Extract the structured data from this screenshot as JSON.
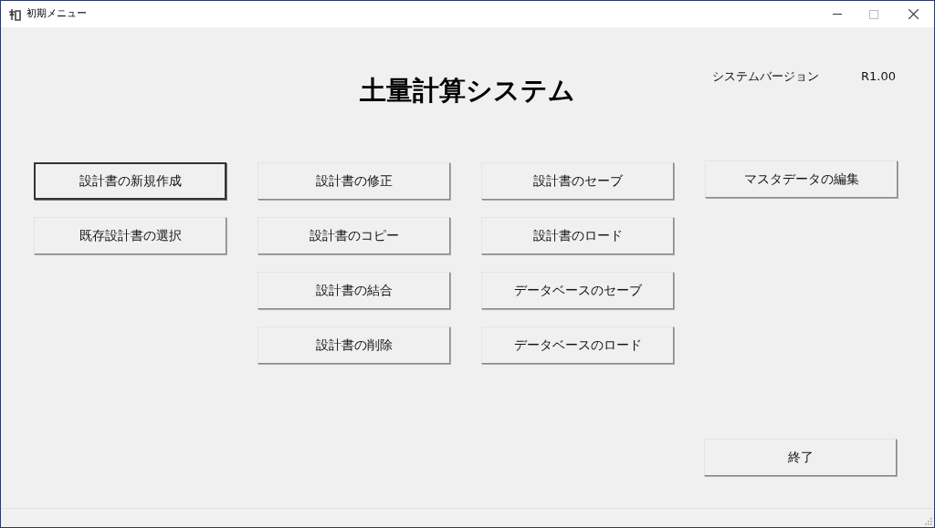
{
  "window": {
    "title": "初期メニュー"
  },
  "heading": "土量計算システム",
  "version": {
    "label": "システムバージョン",
    "value": "R1.00"
  },
  "columns": [
    [
      {
        "label": "設計書の新規作成",
        "focused": true
      },
      {
        "label": "既存設計書の選択",
        "focused": false
      }
    ],
    [
      {
        "label": "設計書の修正",
        "focused": false
      },
      {
        "label": "設計書のコピー",
        "focused": false
      },
      {
        "label": "設計書の結合",
        "focused": false
      },
      {
        "label": "設計書の削除",
        "focused": false
      }
    ],
    [
      {
        "label": "設計書のセーブ",
        "focused": false
      },
      {
        "label": "設計書のロード",
        "focused": false
      },
      {
        "label": "データベースのセーブ",
        "focused": false
      },
      {
        "label": "データベースのロード",
        "focused": false
      }
    ],
    [
      {
        "label": "マスタデータの編集",
        "focused": false
      }
    ]
  ],
  "exit_button": {
    "label": "終了",
    "focused": false
  }
}
